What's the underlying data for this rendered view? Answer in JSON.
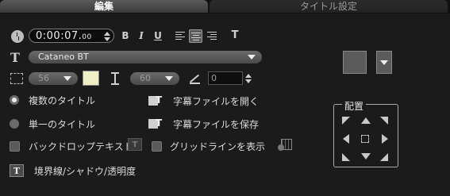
{
  "tabs": {
    "edit": "編集",
    "title_settings": "タイトル設定"
  },
  "timecode": {
    "main": "0:00:07.",
    "frames": "00"
  },
  "format": {
    "bold": "B",
    "italic": "I",
    "underline": "U",
    "vertical": "T"
  },
  "font": {
    "name": "Cataneo BT"
  },
  "size": {
    "value": "56"
  },
  "line_spacing": {
    "value": "60"
  },
  "angle": {
    "value": "0"
  },
  "colors": {
    "text_swatch": "#efefc6",
    "accent": "#5b5b5b"
  },
  "options": {
    "multi_title": "複数のタイトル",
    "single_title": "単一のタイトル",
    "backdrop_text": "バックドロップテキスト",
    "show_gridlines": "グリッドラインを表示",
    "border_shadow": "境界線/シャドウ/透明度",
    "open_subtitle": "字幕ファイルを開く",
    "save_subtitle": "字幕ファイルを保存"
  },
  "placement": {
    "title": "配置"
  }
}
